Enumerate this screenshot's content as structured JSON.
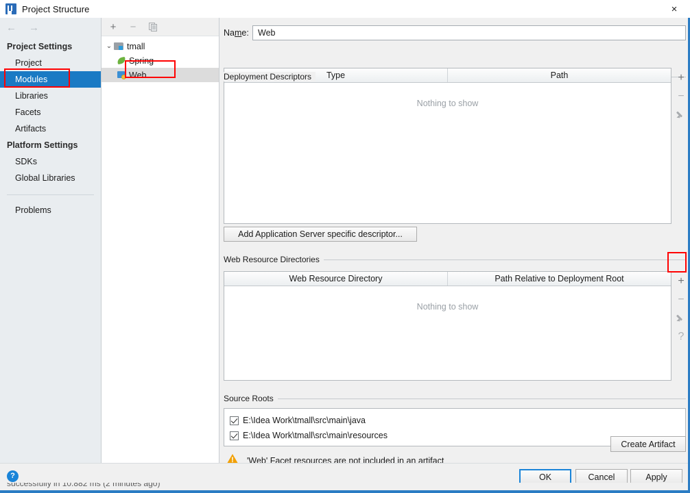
{
  "window": {
    "title": "Project Structure",
    "logo_icon": "intellij-idea-logo",
    "close_icon": "×"
  },
  "nav": {
    "back_icon": "←",
    "forward_icon": "→"
  },
  "sidebar": {
    "groups": [
      {
        "label": "Project Settings",
        "items": [
          {
            "label": "Project",
            "selected": false
          },
          {
            "label": "Modules",
            "selected": true
          },
          {
            "label": "Libraries",
            "selected": false
          },
          {
            "label": "Facets",
            "selected": false
          },
          {
            "label": "Artifacts",
            "selected": false
          }
        ]
      },
      {
        "label": "Platform Settings",
        "items": [
          {
            "label": "SDKs",
            "selected": false
          },
          {
            "label": "Global Libraries",
            "selected": false
          }
        ]
      }
    ],
    "problems_label": "Problems"
  },
  "tree": {
    "toolbar": [
      {
        "name": "add-module-button",
        "glyph": "+"
      },
      {
        "name": "remove-module-button",
        "glyph": "−"
      },
      {
        "name": "copy-module-button",
        "glyph": "copy"
      }
    ],
    "nodes": [
      {
        "label": "tmall",
        "icon": "module-icon",
        "level": 0,
        "expanded": true,
        "selected": false
      },
      {
        "label": "Spring",
        "icon": "spring-leaf-icon",
        "level": 1,
        "selected": false
      },
      {
        "label": "Web",
        "icon": "web-facet-icon",
        "level": 1,
        "selected": true
      }
    ]
  },
  "main": {
    "name_field": {
      "label_before": "Na",
      "label_mnemonic": "m",
      "label_after": "e:",
      "value": "Web"
    },
    "deployment_descriptors": {
      "section_label": "Deployment Descriptors",
      "columns": [
        "Type",
        "Path"
      ],
      "empty_text": "Nothing to show",
      "rows": [],
      "toolbar": [
        {
          "name": "add-descriptor-button",
          "glyph": "+",
          "enabled": true
        },
        {
          "name": "remove-descriptor-button",
          "glyph": "−",
          "enabled": false
        },
        {
          "name": "edit-descriptor-button",
          "glyph": "pencil",
          "enabled": false
        }
      ]
    },
    "add_descriptor_button": "Add Application Server specific descriptor...",
    "web_resource_directories": {
      "section_label": "Web Resource Directories",
      "columns": [
        "Web Resource Directory",
        "Path Relative to Deployment Root"
      ],
      "empty_text": "Nothing to show",
      "rows": [],
      "toolbar": [
        {
          "name": "add-web-resource-button",
          "glyph": "+",
          "enabled": true
        },
        {
          "name": "remove-web-resource-button",
          "glyph": "−",
          "enabled": false
        },
        {
          "name": "edit-web-resource-button",
          "glyph": "pencil",
          "enabled": false
        },
        {
          "name": "help-web-resource-button",
          "glyph": "?",
          "enabled": true
        }
      ]
    },
    "source_roots": {
      "section_label": "Source Roots",
      "rows": [
        {
          "checked": true,
          "path": "E:\\Idea Work\\tmall\\src\\main\\java"
        },
        {
          "checked": true,
          "path": "E:\\Idea Work\\tmall\\src\\main\\resources"
        }
      ]
    },
    "warning": {
      "icon": "warning-triangle-icon",
      "text": "'Web' Facet resources are not included in an artifact",
      "action_label": "Create Artifact"
    }
  },
  "footer": {
    "help_icon": "?",
    "buttons": [
      {
        "name": "ok-button",
        "label": "OK",
        "primary": true
      },
      {
        "name": "cancel-button",
        "label": "Cancel",
        "primary": false
      },
      {
        "name": "apply-button",
        "label": "Apply",
        "primary": false
      }
    ],
    "background_status_text": "successfully in 10.882 ms (2 minutes ago)"
  },
  "annotations": {
    "highlight_color": "#ff0000",
    "boxes": [
      "sidebar-modules-item",
      "tree-web-node",
      "add-web-resource-button"
    ]
  }
}
